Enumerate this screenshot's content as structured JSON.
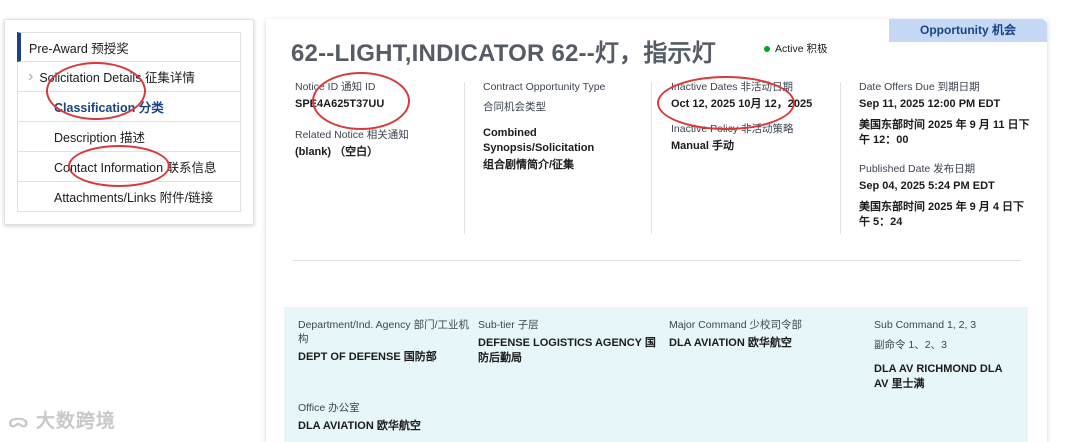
{
  "sidenav": {
    "items": [
      {
        "label": "Pre-Award 预授奖"
      },
      {
        "label": "Solicitation Details 征集详情"
      },
      {
        "label": "Classification 分类"
      },
      {
        "label": "Description 描述"
      },
      {
        "label": "Contact Information 联系信息"
      },
      {
        "label": "Attachments/Links 附件/链接"
      }
    ],
    "chevron": "›"
  },
  "header": {
    "badge": "Opportunity 机会",
    "title": "62--LIGHT,INDICATOR 62--灯，指示灯",
    "status": "Active 积极"
  },
  "details": {
    "notice_id_label": "Notice ID 通知 ID",
    "notice_id_value": "SPE4A625T37UU",
    "related_notice_label": "Related Notice 相关通知",
    "related_notice_value": "(blank) （空白）",
    "contract_type_label": "Contract Opportunity Type",
    "contract_type_label_cn": "合同机会类型",
    "contract_type_value": "Combined Synopsis/Solicitation",
    "contract_type_value_cn": "组合剧情简介/征集",
    "inactive_dates_label": "Inactive Dates 非活动日期",
    "inactive_dates_value": "Oct 12, 2025 10月 12，2025",
    "inactive_policy_label": "Inactive Policy 非活动策略",
    "inactive_policy_value": "Manual 手动",
    "date_offers_due_label": "Date Offers Due 到期日期",
    "date_offers_due_value": "Sep 11, 2025 12:00 PM EDT",
    "date_offers_due_value_cn": "美国东部时间 2025 年 9 月 11 日下午 12：00",
    "published_date_label": "Published Date 发布日期",
    "published_date_value": "Sep 04, 2025 5:24 PM EDT",
    "published_date_value_cn": "美国东部时间 2025 年 9 月 4 日下午 5：24"
  },
  "agency": {
    "department_label": "Department/Ind. Agency 部门/工业机构",
    "department_value": "DEPT OF DEFENSE 国防部",
    "subtier_label": "Sub-tier 子层",
    "subtier_value": "DEFENSE LOGISTICS AGENCY 国防后勤局",
    "major_command_label": "Major Command 少校司令部",
    "major_command_value": "DLA AVIATION 欧华航空",
    "sub_command_label": "Sub Command 1, 2, 3",
    "sub_command_label_cn": "副命令 1、2、3",
    "sub_command_value": "DLA AV RICHMOND DLA AV 里士满",
    "office_label": "Office 办公室",
    "office_value": "DLA AVIATION 欧华航空"
  },
  "watermark": "大数跨境",
  "colors": {
    "accent_blue": "#1a4480",
    "badge_bg": "#c5d9f7",
    "status_green": "#00a91c",
    "section_cyan": "#e7f6f8",
    "annotation_red": "#d63a3a"
  }
}
